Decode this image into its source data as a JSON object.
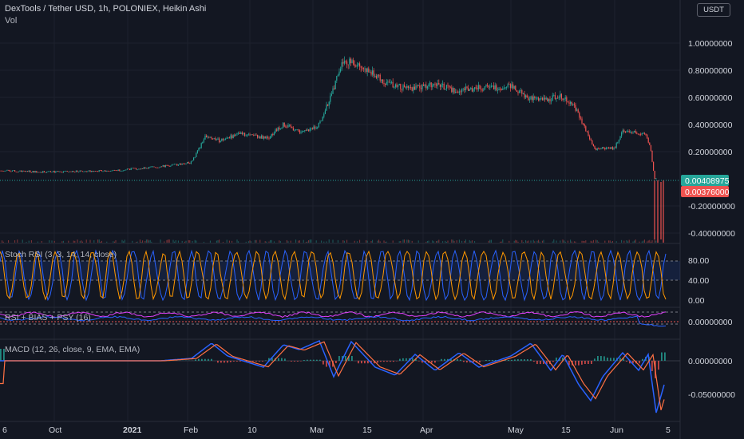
{
  "header": {
    "symbol_line": "DexTools / Tether USD, 1h, POLONIEX, Heikin Ashi",
    "vol_label": "Vol",
    "currency": "USDT"
  },
  "colors": {
    "background": "#131722",
    "up": "#26a69a",
    "down": "#ef5350",
    "grid": "#1e222d",
    "text": "#b2b5be",
    "blue": "#2962ff",
    "orange": "#ff9800"
  },
  "price_pane": {
    "last_price_label": "0.00408975",
    "secondary_price_label": "0.00376000",
    "y_ticks": [
      "1.00000000",
      "0.80000000",
      "0.60000000",
      "0.40000000",
      "0.20000000",
      "-0.20000000",
      "-0.40000000"
    ],
    "y_tick_values": [
      1.0,
      0.8,
      0.6,
      0.4,
      0.2,
      -0.2,
      -0.4
    ]
  },
  "indicators": {
    "stoch_rsi": {
      "label": "Stoch RSI (3, 3, 14, 14, close)",
      "ticks": [
        "80.00",
        "40.00",
        "0.00"
      ]
    },
    "rsi_bias": {
      "label": "RSI + BIAS + PSY (16)",
      "tick": "0.00000000"
    },
    "macd": {
      "label": "MACD (12, 26, close, 9, EMA, EMA)",
      "ticks": [
        "0.00000000",
        "-0.05000000"
      ]
    }
  },
  "x_axis": {
    "labels": [
      "6",
      "Oct",
      "2021",
      "Feb",
      "10",
      "Mar",
      "15",
      "Apr",
      "May",
      "15",
      "Jun",
      "5"
    ]
  },
  "chart_data": {
    "type": "line",
    "title": "DexTools / Tether USD, 1h, POLONIEX, Heikin Ashi",
    "x": [
      "6",
      "Oct",
      "2021",
      "Feb",
      "10",
      "Mar",
      "15",
      "Apr",
      "May",
      "15",
      "Jun",
      "5"
    ],
    "series": [
      {
        "name": "DexTools / Tether USD",
        "values": [
          0.06,
          0.05,
          0.07,
          0.11,
          0.32,
          0.6,
          0.88,
          0.68,
          0.68,
          0.62,
          0.34,
          0.004
        ]
      }
    ],
    "ylim": [
      -0.45,
      1.08
    ],
    "grid": true,
    "last_value": 0.00408975
  }
}
